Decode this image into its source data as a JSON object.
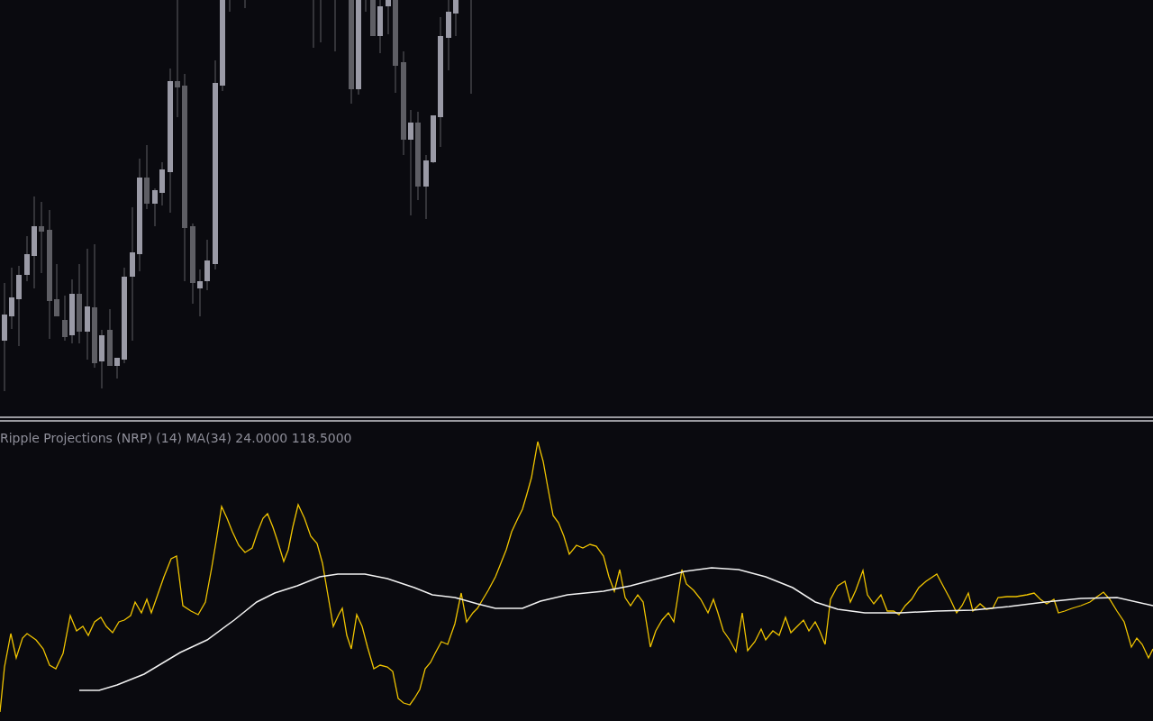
{
  "indicator_pane": {
    "label": "Ripple Projections (NRP) (14) MA(34) 24.0000 118.5000"
  }
}
